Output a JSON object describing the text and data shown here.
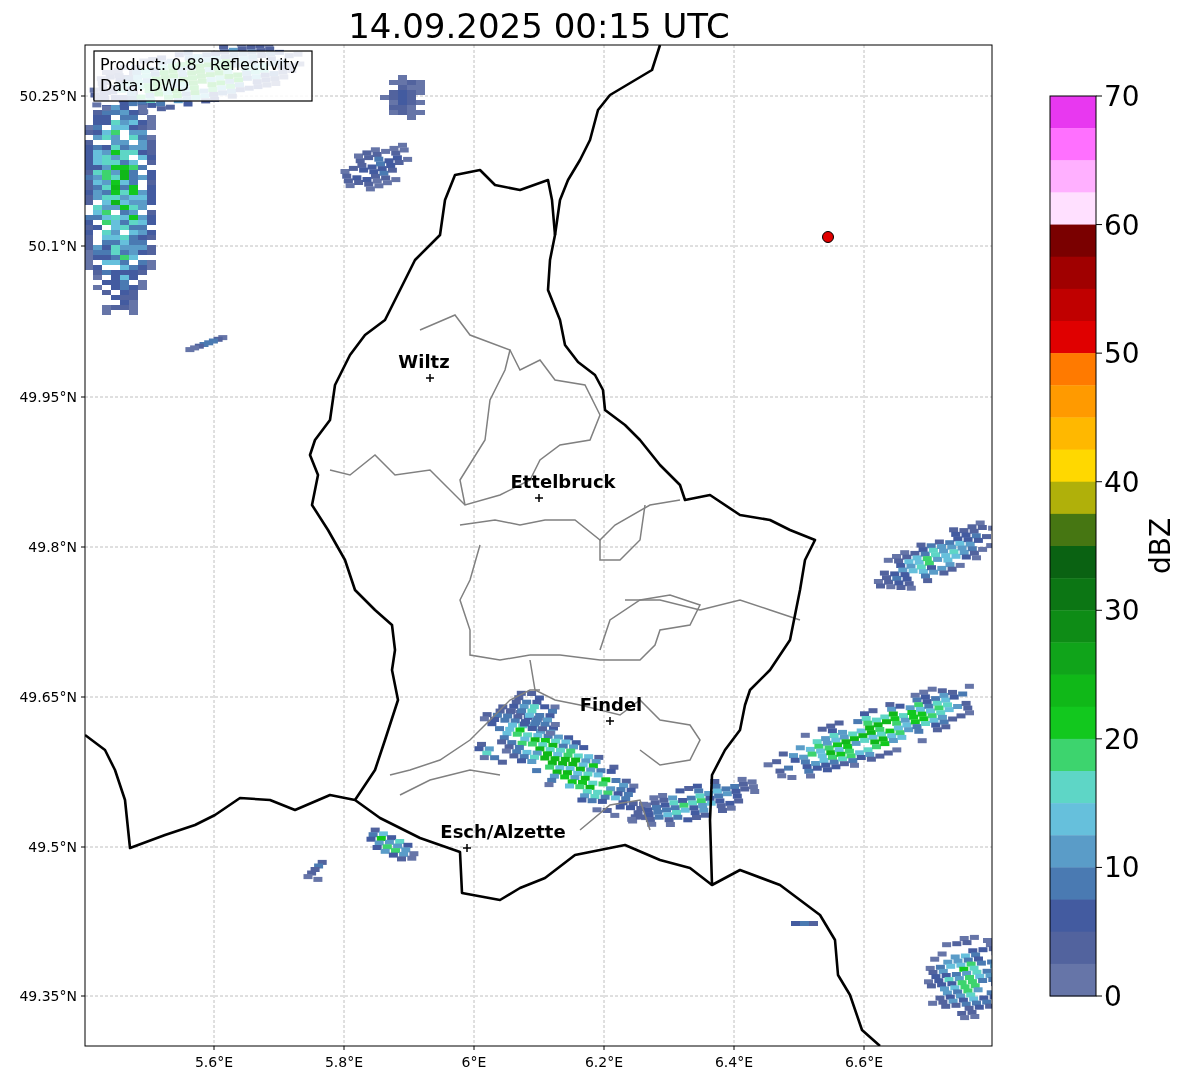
{
  "title": "14.09.2025 00:15 UTC",
  "info_box": [
    "Product: 0.8° Reflectivity",
    "Data: DWD"
  ],
  "y_ticks": [
    "50.25°N",
    "50.1°N",
    "49.95°N",
    "49.8°N",
    "49.65°N",
    "49.5°N",
    "49.35°N"
  ],
  "x_ticks": [
    "5.6°E",
    "5.8°E",
    "6°E",
    "6.2°E",
    "6.4°E",
    "6.6°E"
  ],
  "cities": [
    {
      "name": "Wiltz"
    },
    {
      "name": "Ettelbruck"
    },
    {
      "name": "Findel"
    },
    {
      "name": "Esch/Alzette"
    }
  ],
  "colorbar": {
    "label": "dBZ",
    "ticks": [
      "70",
      "60",
      "50",
      "40",
      "30",
      "20",
      "10",
      "0"
    ],
    "bins": [
      {
        "color": "#e838f0"
      },
      {
        "color": "#ff70ff"
      },
      {
        "color": "#ffb0ff"
      },
      {
        "color": "#ffe0ff"
      },
      {
        "color": "#7a0000"
      },
      {
        "color": "#a00000"
      },
      {
        "color": "#c00000"
      },
      {
        "color": "#e00000"
      },
      {
        "color": "#ff7a00"
      },
      {
        "color": "#ff9a00"
      },
      {
        "color": "#ffb800"
      },
      {
        "color": "#ffd800"
      },
      {
        "color": "#b0b00a"
      },
      {
        "color": "#467612"
      },
      {
        "color": "#0a6212"
      },
      {
        "color": "#0c7614"
      },
      {
        "color": "#0e8c16"
      },
      {
        "color": "#10a41a"
      },
      {
        "color": "#10b818"
      },
      {
        "color": "#12c81e"
      },
      {
        "color": "#3dd46e"
      },
      {
        "color": "#5ed6c6"
      },
      {
        "color": "#66c0dc"
      },
      {
        "color": "#5a9cc8"
      },
      {
        "color": "#4a7ab2"
      },
      {
        "color": "#435ba0"
      },
      {
        "color": "#52639e"
      },
      {
        "color": "#6675a8"
      }
    ]
  }
}
